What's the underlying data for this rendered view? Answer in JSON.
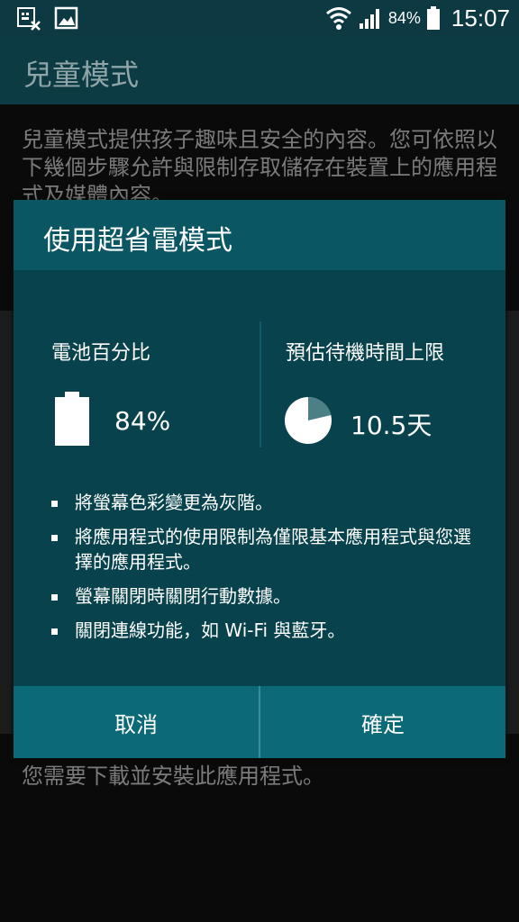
{
  "status_bar": {
    "battery_percent": "84%",
    "time": "15:07",
    "icons": [
      "keyboard-off-icon",
      "image-icon",
      "wifi-icon",
      "signal-icon",
      "battery-icon"
    ]
  },
  "background_app": {
    "title": "兒童模式",
    "description": "兒童模式提供孩子趣味且安全的內容。您可依照以下幾個步驟允許與限制存取儲存在裝置上的應用程式及媒體內容。",
    "footer_text": "您需要下載並安裝此應用程式。"
  },
  "dialog": {
    "title": "使用超省電模式",
    "battery_label": "電池百分比",
    "battery_value": "84%",
    "battery_level": 0.84,
    "standby_label": "預估待機時間上限",
    "standby_value": "10.5天",
    "bullets": [
      "將螢幕色彩變更為灰階。",
      "將應用程式的使用限制為僅限基本應用程式與您選擇的應用程式。",
      "螢幕關閉時關閉行動數據。",
      "關閉連線功能，如 Wi-Fi 與藍牙。"
    ],
    "cancel_label": "取消",
    "ok_label": "確定"
  },
  "colors": {
    "dialog_bg": "#08434d",
    "dialog_header": "#0a5663",
    "button_bar": "#0c6a78",
    "statusbar": "#0d3a42"
  }
}
